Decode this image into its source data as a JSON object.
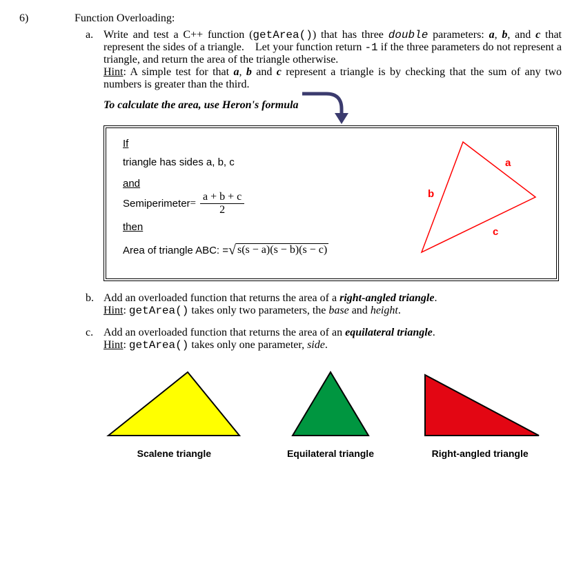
{
  "question": {
    "number": "6)",
    "title": "Function Overloading:"
  },
  "parts": {
    "a": {
      "letter": "a.",
      "text_pre": "Write and test a C++ function (",
      "fn": "getArea()",
      "text_mid1": ") that has three ",
      "type": "double",
      "text_mid2": " parameters: ",
      "p_a": "a",
      "p_b": "b",
      "text_mid3": ", and ",
      "p_c": "c",
      "text_mid4": " that represent the sides of a triangle. Let your function return ",
      "neg1": "-1",
      "text_mid5": " if the three parameters do not represent a triangle, and return the area of the triangle otherwise.",
      "hint_label": "Hint",
      "hint_pre": ": A simple test for that ",
      "h_a": "a",
      "h_b": "b",
      "hint_mid1": " and ",
      "h_c": "c",
      "hint_rest": " represent a triangle is by checking that the sum of any two numbers is greater than the third."
    },
    "heron_title": "To calculate the area, use Heron's formula",
    "heron": {
      "if": "If",
      "sides": "triangle has sides a, b, c",
      "and": "and",
      "semiperimeter_label": "Semiperimeter",
      "eq": " = ",
      "frac_num": "a + b + c",
      "frac_den": "2",
      "then": "then",
      "area_label": "Area of triangle ABC:  = ",
      "sqrt_arg": "s(s − a)(s − b)(s − c)",
      "labels": {
        "a": "a",
        "b": "b",
        "c": "c"
      }
    },
    "b": {
      "letter": "b.",
      "text_pre": "Add an overloaded function that returns the area of a ",
      "emph": "right-angled triangle",
      "text_post": ".",
      "hint_label": "Hint",
      "hint_pre": ": ",
      "fn": "getArea()",
      "hint_mid": " takes only two parameters, the ",
      "p1": "base",
      "and": " and ",
      "p2": "height",
      "hint_end": "."
    },
    "c": {
      "letter": "c.",
      "text_pre": "Add an overloaded function that returns the area of an ",
      "emph": "equilateral triangle",
      "text_post": ".",
      "hint_label": "Hint",
      "hint_pre": ": ",
      "fn": "getArea()",
      "hint_mid": " takes only one parameter, ",
      "p1": "side",
      "hint_end": "."
    }
  },
  "triangles": {
    "scalene": "Scalene triangle",
    "equilateral": "Equilateral triangle",
    "right": "Right-angled triangle"
  }
}
